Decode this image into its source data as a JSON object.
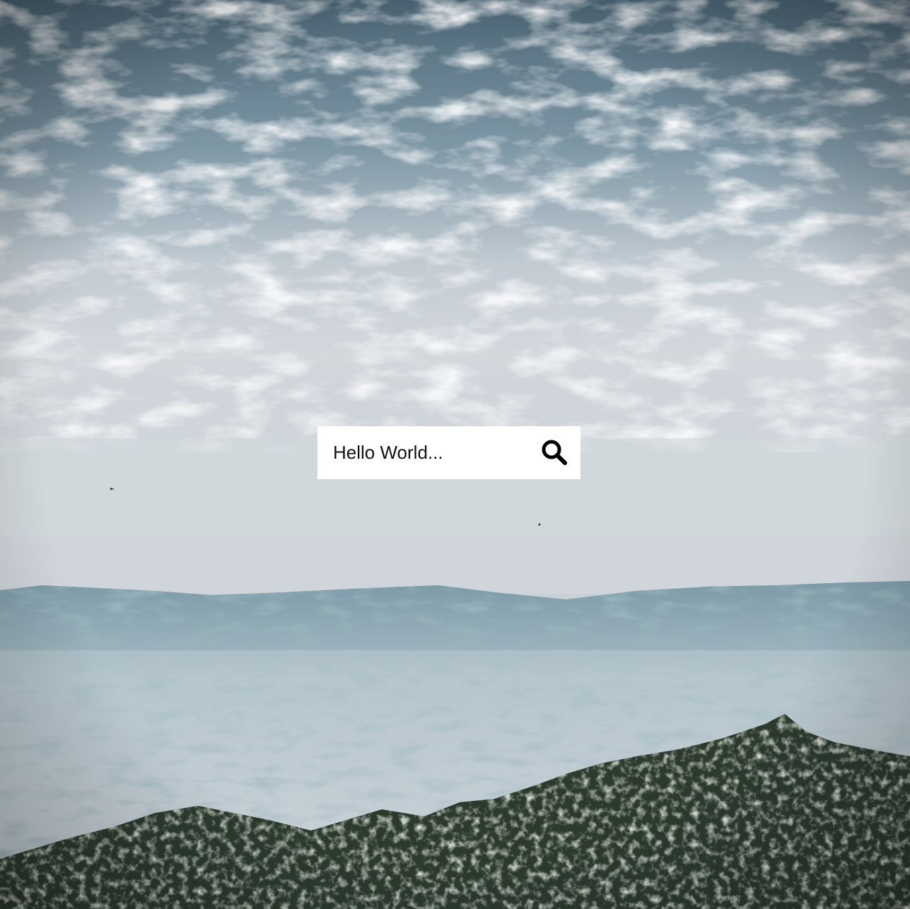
{
  "search": {
    "placeholder": "Hello World...",
    "icon": "search-icon"
  },
  "background": {
    "scene": "cloudy-sky-over-valley",
    "icon": "landscape-photo"
  },
  "colors": {
    "sky_dark": "#3f5968",
    "sky_light": "#dfe3e8",
    "haze": "#c7ced5",
    "mountain": "#6f93a0",
    "valley": "#c4cdd4",
    "trees": "#2f3d2f",
    "search_bg": "#ffffff",
    "text": "#111111"
  }
}
